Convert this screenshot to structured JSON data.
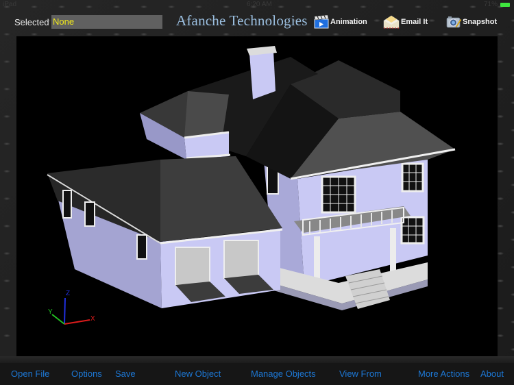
{
  "status_bar": {
    "device": "iPad",
    "wifi_icon": "wifi-icon",
    "time": "6:20 AM",
    "battery_percent": "71%",
    "battery_level": 0.71
  },
  "header": {
    "selected_label": "Selected",
    "selected_value": "None",
    "brand_title": "Afanche Technologies",
    "buttons": [
      {
        "label": "Animation",
        "icon": "clapperboard-icon"
      },
      {
        "label": "Email It",
        "icon": "envelope-icon"
      },
      {
        "label": "Snapshot",
        "icon": "camera-icon"
      }
    ]
  },
  "viewport": {
    "model": "3d-house-model",
    "axes": {
      "x": "X",
      "y": "Y",
      "z": "Z"
    },
    "colors": {
      "background": "#000000",
      "wall": "#c8c8f5",
      "roof": "#3c3c3c",
      "trim": "#eeeeee",
      "x_axis": "#e01c1c",
      "y_axis": "#22c022",
      "z_axis": "#2030e0"
    }
  },
  "bottom_nav": {
    "items": [
      {
        "label": "Open File"
      },
      {
        "label": "Options"
      },
      {
        "label": "Save"
      },
      {
        "label": "New Object"
      },
      {
        "label": "Manage Objects"
      },
      {
        "label": "View From"
      },
      {
        "label": "More Actions"
      },
      {
        "label": "About"
      }
    ],
    "accent": "#1d78d6"
  }
}
